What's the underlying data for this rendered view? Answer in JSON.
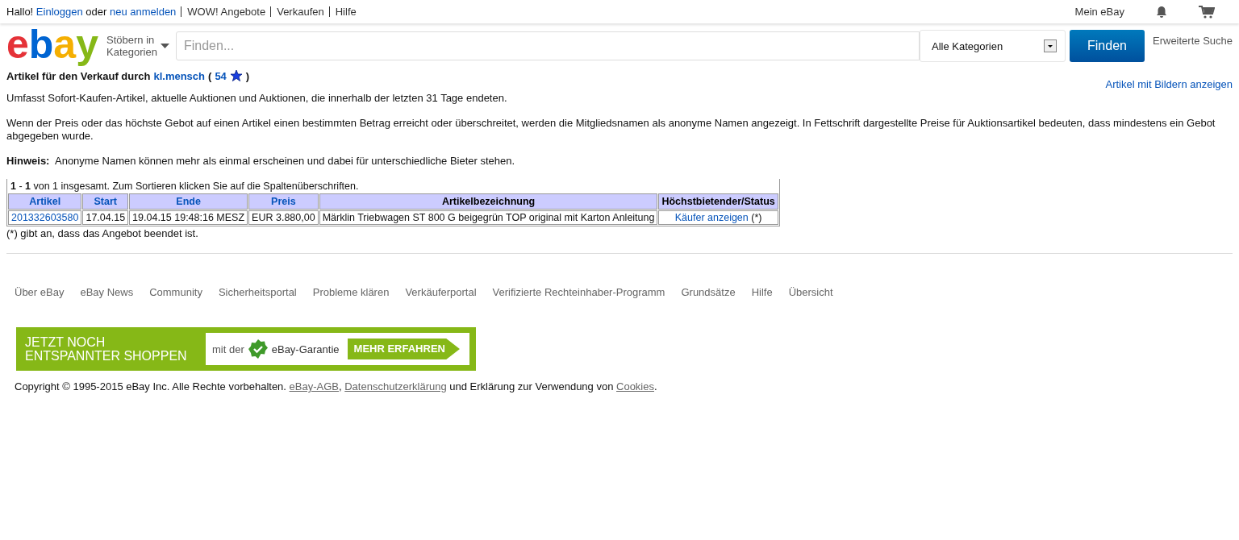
{
  "topbar": {
    "greeting": "Hallo!",
    "login_link": "Einloggen",
    "or_text": "oder",
    "register_link": "neu anmelden",
    "links": [
      "WOW! Angebote",
      "Verkaufen",
      "Hilfe"
    ],
    "my_ebay": "Mein eBay"
  },
  "header": {
    "logo": "ebay",
    "browse": "Stöbern in Kategorien",
    "search_placeholder": "Finden...",
    "category": "Alle Kategorien",
    "search_button": "Finden",
    "advanced": "Erweiterte Suche"
  },
  "seller": {
    "heading": "Artikel für den Verkauf durch",
    "name": "kl.mensch",
    "open": "(",
    "rating": "54",
    "close": ")"
  },
  "show_with_images": "Artikel mit Bildern anzeigen",
  "paragraphs": [
    "Umfasst Sofort-Kaufen-Artikel, aktuelle Auktionen und Auktionen, die innerhalb der letzten 31 Tage endeten.",
    "Wenn der Preis oder das höchste Gebot auf einen Artikel einen bestimmten Betrag erreicht oder überschreitet, werden die Mitgliedsnamen als anonyme Namen angezeigt. In Fettschrift dargestellte Preise für Auktionsartikel bedeuten, dass mindestens ein Gebot abgegeben wurde."
  ],
  "note": "**Hinweis:**  Anonyme Namen können mehr als einmal erscheinen und dabei für unterschiedliche Bieter stehen.",
  "table": {
    "summary": "**1** - **1** von 1 insgesamt. Zum Sortieren klicken Sie auf die Spaltenüberschriften.",
    "columns": [
      {
        "label": "Artikel",
        "sortable": true
      },
      {
        "label": "Start",
        "sortable": true
      },
      {
        "label": "Ende",
        "sortable": true
      },
      {
        "label": "Preis",
        "sortable": true
      },
      {
        "label": "Artikelbezeichnung",
        "sortable": false
      },
      {
        "label": "Höchstbietender/Status",
        "sortable": false
      }
    ],
    "rows": [
      {
        "item": "201332603580",
        "start": "17.04.15",
        "end": "19.04.15 19:48:16 MESZ",
        "price": "EUR 3.880,00",
        "title": "Märklin Triebwagen ST 800 G beigegrün TOP original mit Karton Anleitung",
        "buyer_link": "Käufer anzeigen",
        "status": "(*)"
      }
    ],
    "footnote": "(*) gibt an, dass das Angebot beendet ist."
  },
  "footer_links": [
    "Über eBay",
    "eBay News",
    "Community",
    "Sicherheitsportal",
    "Probleme klären",
    "Verkäuferportal",
    "Verifizierte Rechteinhaber-Programm",
    "Grundsätze",
    "Hilfe",
    "Übersicht"
  ],
  "banner": {
    "headline_1": "JETZT NOCH",
    "headline_2": "ENTSPANNTER SHOPPEN",
    "prefix": "mit der",
    "guarantee": "eBay-Garantie",
    "cta": "MEHR ERFAHREN"
  },
  "copyright": {
    "text": "Copyright © 1995-2015 eBay Inc. Alle Rechte vorbehalten.",
    "agb": "eBay-AGB",
    "comma": ",",
    "privacy": "Datenschutzerklärung",
    "mid": "und Erklärung zur Verwendung von",
    "cookies": "Cookies",
    "end": "."
  }
}
